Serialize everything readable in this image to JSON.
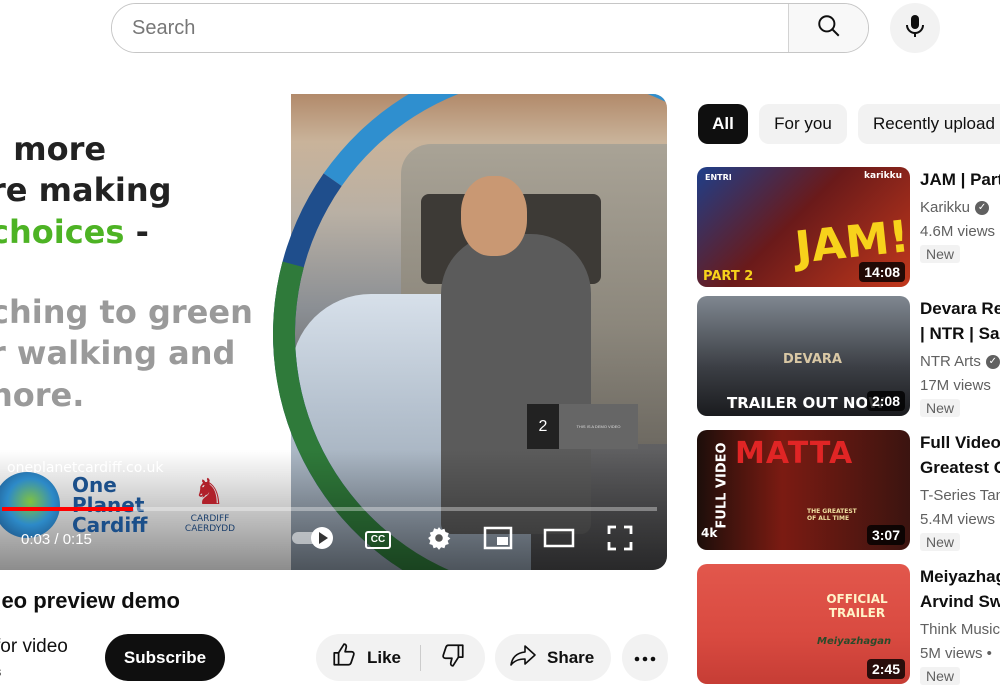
{
  "search": {
    "placeholder": "Search"
  },
  "icons": {
    "search": "search-icon",
    "mic": "microphone-icon",
    "play": "play-icon",
    "cc": "closed-captions-icon",
    "settings": "gear-icon",
    "miniplayer": "miniplayer-icon",
    "theater": "theater-mode-icon",
    "fullscreen": "fullscreen-icon",
    "like": "thumbs-up-icon",
    "dislike": "thumbs-down-icon",
    "share": "share-icon",
    "more": "more-horizontal-icon"
  },
  "player": {
    "slide_lines": [
      ". more",
      "re making",
      "choices",
      "ching to green",
      "r walking and",
      "nore."
    ],
    "green_dash": " -",
    "url": "oneplanetcardiff.co.uk",
    "logo_text_1": "One",
    "logo_text_2": "Planet",
    "logo_text_3": "Cardiff",
    "council_1": "CARDIFF",
    "council_2": "CAERDYDD",
    "preview_number": "2",
    "preview_caption": "THIS IS A DEMO VIDEO",
    "time": "0:03 / 0:15",
    "progress_fraction": 0.2,
    "cc_label": "CC"
  },
  "video": {
    "title": "deo preview demo",
    "channel": "for video",
    "channel_sub": "s",
    "subscribe_label": "Subscribe",
    "like_label": "Like",
    "share_label": "Share"
  },
  "chips": [
    "All",
    "For you",
    "Recently upload"
  ],
  "recommendations": [
    {
      "title_1": "JAM | Part",
      "title_2": "",
      "channel": "Karikku",
      "verified": true,
      "views": "4.6M views",
      "badge": "New",
      "duration": "14:08",
      "thumb_top": "ENTRI",
      "thumb_tag": "karikku",
      "thumb_big": "JAM!",
      "thumb_part": "PART 2"
    },
    {
      "title_1": "Devara Re",
      "title_2": "| NTR | Sai",
      "channel": "NTR Arts",
      "verified": true,
      "views": "17M views",
      "badge": "New",
      "duration": "2:08",
      "thumb_big": "DEVARA",
      "thumb_bottom": "TRAILER OUT NOW"
    },
    {
      "title_1": "Full Video",
      "title_2": "Greatest O",
      "channel": "T-Series Tam",
      "verified": false,
      "views": "5.4M views",
      "badge": "New",
      "duration": "3:07",
      "thumb_side": "FULL VIDEO",
      "thumb_big": "MATTA",
      "thumb_sub": "THE GREATEST OF ALL TIME",
      "thumb_4k": "4k"
    },
    {
      "title_1": "Meiyazhag",
      "title_2": "Arvind Sw",
      "channel": "Think Music",
      "verified": false,
      "views": "5M views",
      "views_suffix": " •",
      "badge": "New",
      "duration": "2:45",
      "thumb_big": "OFFICIAL TRAILER",
      "thumb_sub": "Meiyazhagan"
    }
  ]
}
